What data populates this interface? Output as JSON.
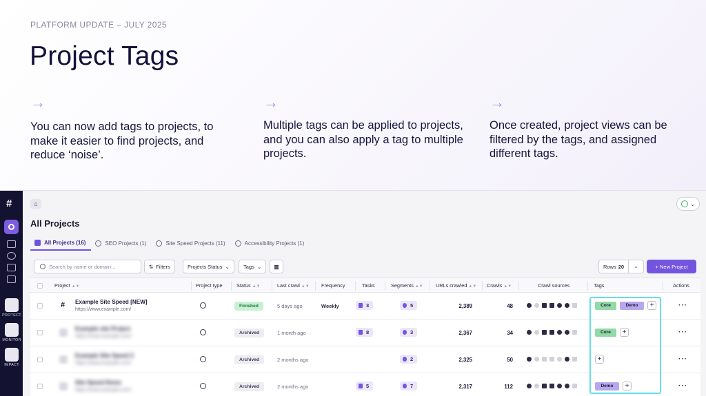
{
  "hero": {
    "eyebrow": "PLATFORM UPDATE – JULY 2025",
    "title": "Project Tags",
    "arrow": "→",
    "features": [
      "You can now add tags to projects, to make it easier to find projects, and reduce ‘noise’.",
      "Multiple tags can be applied to projects, and you can also apply a tag to multiple projects.",
      "Once created, project views can be filtered by the tags, and assigned different tags."
    ]
  },
  "rail": {
    "logo": "#",
    "modules": [
      "PROTECT",
      "MONITOR",
      "IMPACT"
    ]
  },
  "page": {
    "title": "All Projects",
    "tabs": [
      {
        "label": "All Projects (16)"
      },
      {
        "label": "SEO Projects (1)"
      },
      {
        "label": "Site Speed Projects (11)"
      },
      {
        "label": "Accessibility Projects (1)"
      }
    ]
  },
  "toolbar": {
    "search_placeholder": "Search by name or domain...",
    "filters_label": "Filters",
    "status_label": "Projects Status",
    "tags_label": "Tags",
    "rows_label": "Rows",
    "rows_value": "20",
    "new_project_label": "+ New Project"
  },
  "table": {
    "columns": [
      "Project",
      "Project type",
      "Status",
      "Last crawl",
      "Frequency",
      "Tasks",
      "Segments",
      "URLs crawled",
      "Crawls",
      "Crawl sources",
      "Tags",
      "Actions"
    ],
    "rows": [
      {
        "name": "Example Site Speed [NEW]",
        "url": "https://www.example.com/",
        "type": "speed",
        "status": "Finished",
        "last_crawl": "5 days ago",
        "frequency": "Weekly",
        "tasks": "3",
        "segments": "5",
        "urls": "2,389",
        "crawls": "48",
        "tags": [
          "Core",
          "Demo"
        ],
        "blurred": false
      },
      {
        "name": "Example site Project",
        "url": "https://www.example.com/",
        "type": "globe",
        "status": "Archived",
        "last_crawl": "1 month ago",
        "frequency": "",
        "tasks": "8",
        "segments": "3",
        "urls": "2,367",
        "crawls": "34",
        "tags": [
          "Core"
        ],
        "blurred": true
      },
      {
        "name": "Example Site Speed 2",
        "url": "https://www.example.com/",
        "type": "speed",
        "status": "Archived",
        "last_crawl": "2 months ago",
        "frequency": "",
        "tasks": "",
        "segments": "2",
        "urls": "2,325",
        "crawls": "50",
        "tags": [],
        "blurred": true
      },
      {
        "name": "Site Speed Demo",
        "url": "https://www.example.com/",
        "type": "speed",
        "status": "Archived",
        "last_crawl": "2 months ago",
        "frequency": "",
        "tasks": "5",
        "segments": "7",
        "urls": "2,317",
        "crawls": "112",
        "tags": [
          "Demo"
        ],
        "blurred": true
      }
    ]
  },
  "colors": {
    "accent": "#7355df",
    "rail": "#141231",
    "tag_core": "#91d9a6",
    "tag_demo": "#b8a7ee",
    "highlight": "#62e0ea"
  }
}
